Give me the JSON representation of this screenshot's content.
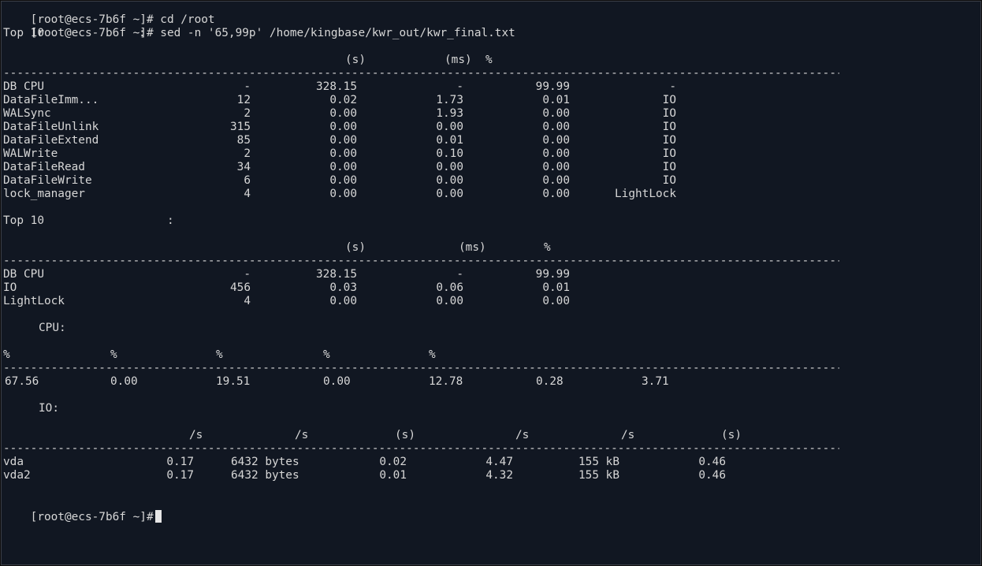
{
  "terminal": {
    "prompt": "[root@ecs-7b6f ~]#",
    "cmd1": "cd /root",
    "cmd2": "sed -n '65,99p' /home/kingbase/kwr_out/kwr_final.txt",
    "dashes": "-------------------------------------------------------------------------------------------------------------------------------------------------------------------------------------------------------------------------"
  },
  "wait_events": {
    "title": "Top 10",
    "title_colon": ":",
    "headers": [
      "(s)",
      "(ms)",
      "%"
    ],
    "rows": [
      {
        "name": "DB CPU",
        "waits": "-",
        "time_s": "328.15",
        "avg_ms": "-",
        "pct": "99.99",
        "class": "-"
      },
      {
        "name": "DataFileImm...",
        "waits": "12",
        "time_s": "0.02",
        "avg_ms": "1.73",
        "pct": "0.01",
        "class": "IO"
      },
      {
        "name": "WALSync",
        "waits": "2",
        "time_s": "0.00",
        "avg_ms": "1.93",
        "pct": "0.00",
        "class": "IO"
      },
      {
        "name": "DataFileUnlink",
        "waits": "315",
        "time_s": "0.00",
        "avg_ms": "0.00",
        "pct": "0.00",
        "class": "IO"
      },
      {
        "name": "DataFileExtend",
        "waits": "85",
        "time_s": "0.00",
        "avg_ms": "0.01",
        "pct": "0.00",
        "class": "IO"
      },
      {
        "name": "WALWrite",
        "waits": "2",
        "time_s": "0.00",
        "avg_ms": "0.10",
        "pct": "0.00",
        "class": "IO"
      },
      {
        "name": "DataFileRead",
        "waits": "34",
        "time_s": "0.00",
        "avg_ms": "0.00",
        "pct": "0.00",
        "class": "IO"
      },
      {
        "name": "DataFileWrite",
        "waits": "6",
        "time_s": "0.00",
        "avg_ms": "0.00",
        "pct": "0.00",
        "class": "IO"
      },
      {
        "name": "lock_manager",
        "waits": "4",
        "time_s": "0.00",
        "avg_ms": "0.00",
        "pct": "0.00",
        "class": "LightLock"
      }
    ]
  },
  "wait_classes": {
    "title": "Top 10",
    "title_colon": ":",
    "headers": [
      "(s)",
      "(ms)",
      "%"
    ],
    "rows": [
      {
        "name": "DB CPU",
        "waits": "-",
        "time_s": "328.15",
        "avg_ms": "-",
        "pct": "99.99"
      },
      {
        "name": "IO",
        "waits": "456",
        "time_s": "0.03",
        "avg_ms": "0.06",
        "pct": "0.01"
      },
      {
        "name": "LightLock",
        "waits": "4",
        "time_s": "0.00",
        "avg_ms": "0.00",
        "pct": "0.00"
      }
    ]
  },
  "cpu": {
    "title": "CPU:",
    "headers": [
      "%",
      "%",
      "%",
      "%",
      "%"
    ],
    "values": [
      "67.56",
      "0.00",
      "19.51",
      "0.00",
      "12.78",
      "0.28",
      "3.71"
    ]
  },
  "io": {
    "title": "IO:",
    "headers": [
      "/s",
      "/s",
      "(s)",
      "/s",
      "/s",
      "(s)"
    ],
    "rows": [
      {
        "dev": "vda",
        "c1": "0.17",
        "c2": "6432 bytes",
        "c3": "0.02",
        "c4": "4.47",
        "c5": "155 kB",
        "c6": "0.46"
      },
      {
        "dev": "vda2",
        "c1": "0.17",
        "c2": "6432 bytes",
        "c3": "0.01",
        "c4": "4.32",
        "c5": "155 kB",
        "c6": "0.46"
      }
    ]
  }
}
